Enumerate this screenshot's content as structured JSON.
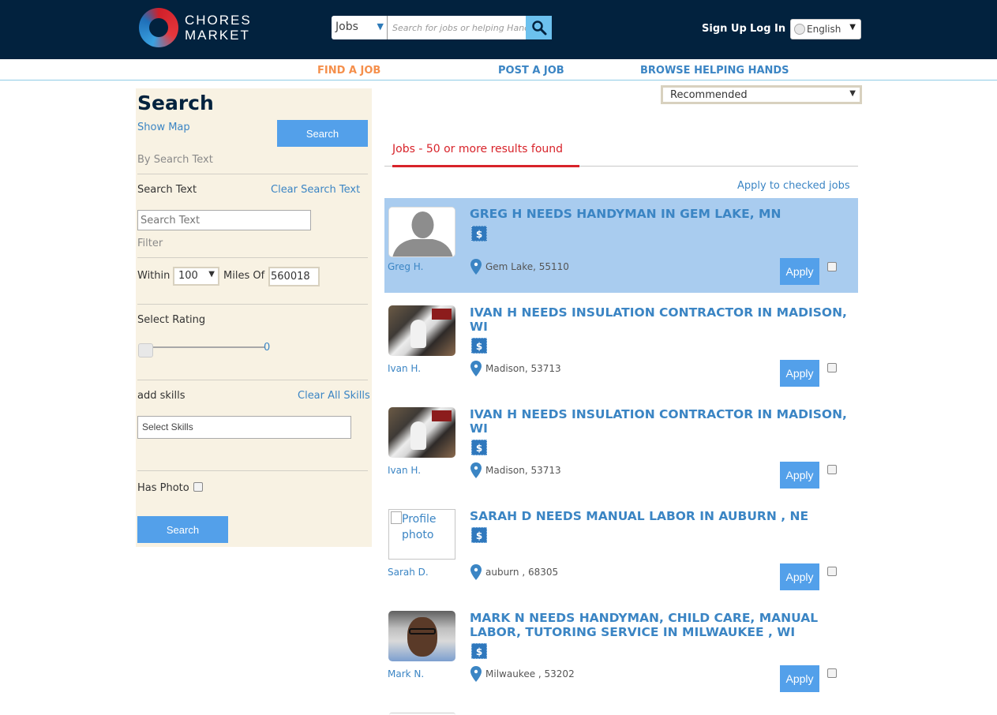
{
  "header": {
    "logo_line1": "CHORES",
    "logo_line2": "MARKET",
    "search_category": "Jobs",
    "search_placeholder": "Search for jobs or helping Hand...",
    "search_icon": "magnifier-icon",
    "sign_up": "Sign Up",
    "log_in": "Log In",
    "language": "English"
  },
  "nav": {
    "items": [
      {
        "label": "FIND A JOB",
        "active": true
      },
      {
        "label": "POST A JOB",
        "active": false
      },
      {
        "label": "BROWSE HELPING HANDS",
        "active": false
      }
    ]
  },
  "sidebar": {
    "title": "Search",
    "show_map": "Show Map",
    "search_button": "Search",
    "by_search_text": "By Search Text",
    "search_text_label": "Search Text",
    "clear_search_text": "Clear Search Text",
    "search_text_placeholder": "Search Text",
    "search_text_value": "",
    "filter_label": "Filter",
    "within_label": "Within",
    "within_value": "100",
    "miles_of_label": "Miles Of",
    "miles_of_value": "560018",
    "select_rating_label": "Select Rating",
    "rating_value": "0",
    "add_skills_label": "add skills",
    "clear_all_skills": "Clear All Skills",
    "skills_placeholder": "Select Skills",
    "has_photo_label": "Has Photo",
    "has_photo_checked": false,
    "bottom_search_button": "Search"
  },
  "results": {
    "sort_value": "Recommended",
    "heading": "Jobs - 50 or more results found",
    "apply_checked": "Apply to checked jobs",
    "pay_icon_label": "$",
    "apply_label": "Apply",
    "jobs": [
      {
        "title": "GREG H NEEDS HANDYMAN IN GEM LAKE, MN",
        "poster": "Greg H.",
        "location": "Gem Lake, 55110",
        "photo": "default-avatar",
        "highlighted": true,
        "checked": false
      },
      {
        "title": "IVAN H NEEDS INSULATION CONTRACTOR IN MADISON, WI",
        "poster": "Ivan H.",
        "location": "Madison, 53713",
        "photo": "insulation-collage",
        "highlighted": false,
        "checked": false
      },
      {
        "title": "IVAN H NEEDS INSULATION CONTRACTOR IN MADISON, WI",
        "poster": "Ivan H.",
        "location": "Madison, 53713",
        "photo": "insulation-collage",
        "highlighted": false,
        "checked": false
      },
      {
        "title": "SARAH D NEEDS MANUAL LABOR IN AUBURN , NE",
        "poster": "Sarah D.",
        "location": "auburn , 68305",
        "photo": "broken-image",
        "photo_alt": "Profile photo",
        "highlighted": false,
        "checked": false
      },
      {
        "title": "MARK N NEEDS HANDYMAN, CHILD CARE, MANUAL LABOR, TUTORING SERVICE IN MILWAUKEE , WI",
        "poster": "Mark N.",
        "location": "Milwaukee , 53202",
        "photo": "selfie",
        "highlighted": false,
        "checked": false
      }
    ]
  },
  "colors": {
    "header_bg": "#02223e",
    "accent_blue": "#3b85c4",
    "button_blue": "#53a0ea",
    "nav_active": "#f58f4b",
    "results_red": "#d8232a",
    "highlight_row": "#a9ccef",
    "sidebar_bg": "#f8f2e3"
  }
}
